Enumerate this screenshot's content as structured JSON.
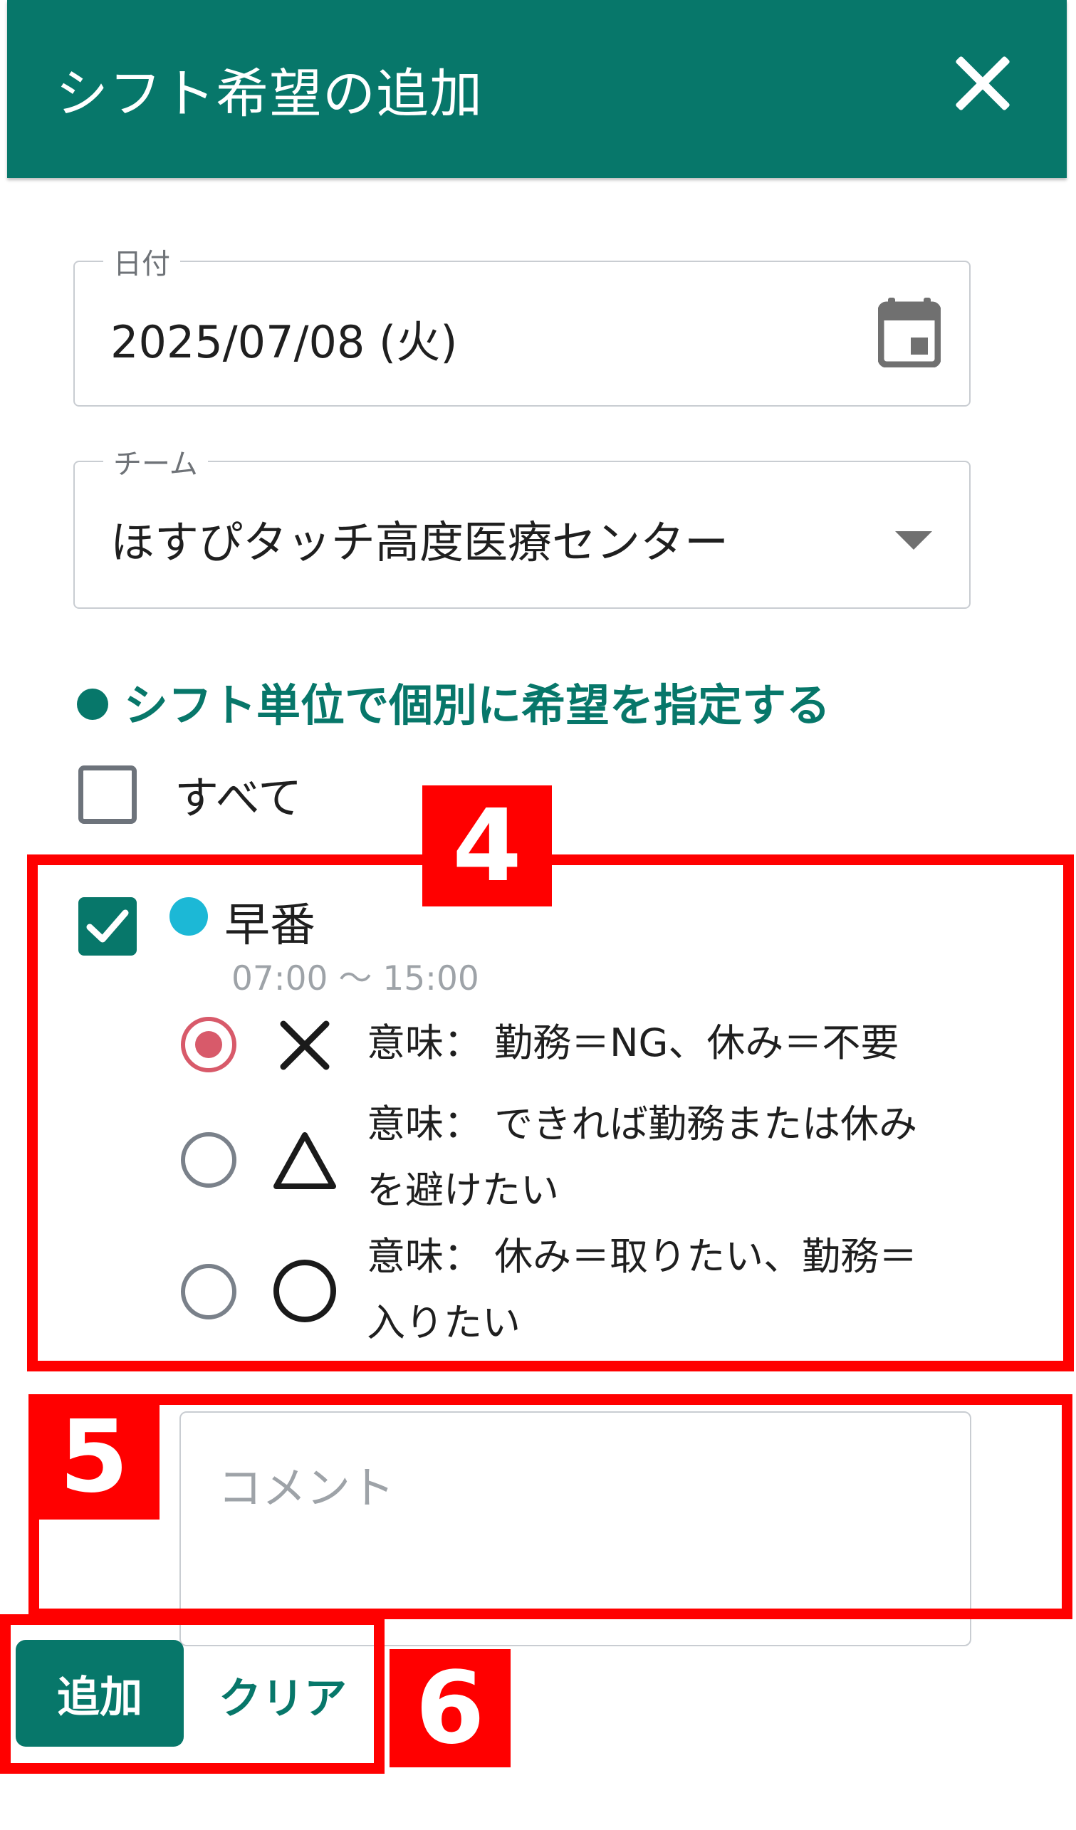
{
  "dialog": {
    "title": "シフト希望の追加"
  },
  "date_field": {
    "label": "日付",
    "value": "2025/07/08 (火)"
  },
  "team_field": {
    "label": "チーム",
    "value": "ほすぴタッチ高度医療センター"
  },
  "section": {
    "heading": "シフト単位で個別に希望を指定する"
  },
  "select_all": {
    "label": "すべて",
    "checked": false
  },
  "shift": {
    "name": "早番",
    "time": "07:00 〜 15:00",
    "checked": true,
    "dot_color": "#1cb8d6"
  },
  "options": [
    {
      "symbol": "✕",
      "meaning": "意味： 勤務＝NG、休み＝不要",
      "selected": true
    },
    {
      "symbol": "△",
      "meaning": "意味： できれば勤務または休みを避けたい",
      "selected": false
    },
    {
      "symbol": "○",
      "meaning": "意味： 休み＝取りたい、勤務＝入りたい",
      "selected": false
    }
  ],
  "comment": {
    "placeholder": "コメント"
  },
  "actions": {
    "add_label": "追加",
    "clear_label": "クリア"
  },
  "annotations": {
    "step4": "4",
    "step5": "5",
    "step6": "6"
  },
  "colors": {
    "primary": "#07776a",
    "radio_selected": "#d85a6a",
    "annotation": "#ff0000"
  }
}
